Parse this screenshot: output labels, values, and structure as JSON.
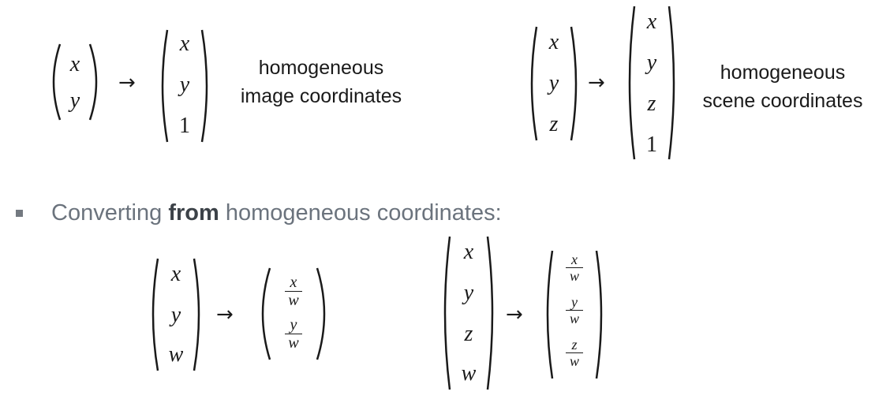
{
  "equations": {
    "eq1": {
      "input": [
        "x",
        "y"
      ],
      "output": [
        "x",
        "y",
        "1"
      ],
      "caption": [
        "homogeneous",
        "image coordinates"
      ]
    },
    "eq2": {
      "input": [
        "x",
        "y",
        "z"
      ],
      "output": [
        "x",
        "y",
        "z",
        "1"
      ],
      "caption": [
        "homogeneous",
        "scene coordinates"
      ]
    },
    "eq3": {
      "input": [
        "x",
        "y",
        "w"
      ],
      "output": [
        {
          "num": "x",
          "den": "w"
        },
        {
          "num": "y",
          "den": "w"
        }
      ]
    },
    "eq4": {
      "input": [
        "x",
        "y",
        "z",
        "w"
      ],
      "output": [
        {
          "num": "x",
          "den": "w"
        },
        {
          "num": "y",
          "den": "w"
        },
        {
          "num": "z",
          "den": "w"
        }
      ]
    }
  },
  "arrow": "→",
  "bullet_text": {
    "before": "Converting ",
    "bold": "from",
    "after": " homogeneous coordinates:"
  }
}
